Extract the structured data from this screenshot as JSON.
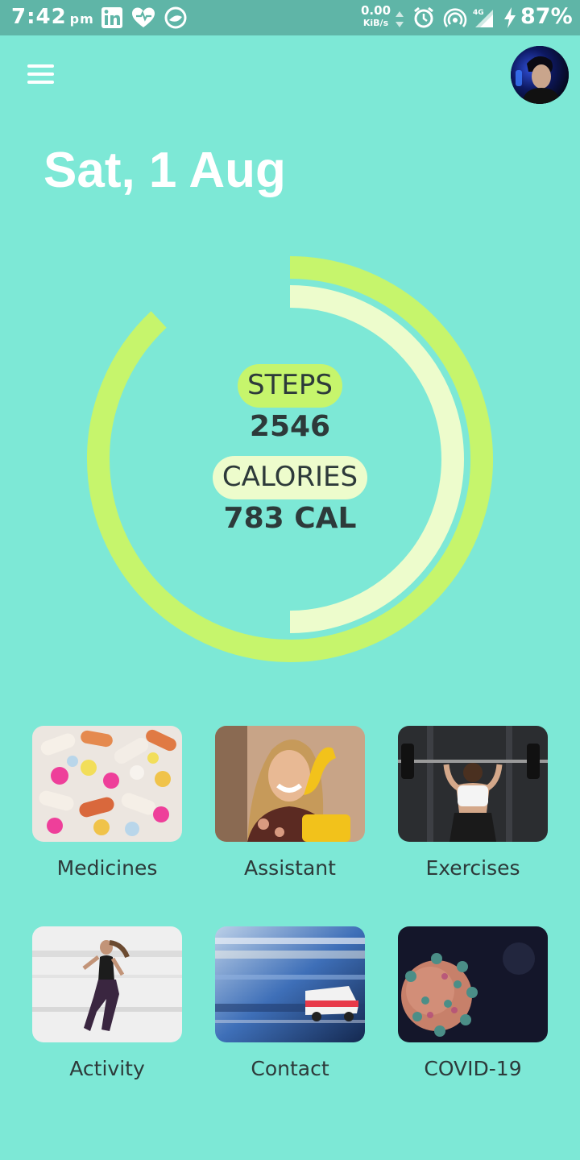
{
  "status_bar": {
    "time": "7:42",
    "ampm": "pm",
    "speed_value": "0.00",
    "speed_unit": "KiB/s",
    "network": "4G",
    "battery": "87%",
    "icons": [
      "linkedin-icon",
      "heart-icon",
      "app-icon",
      "arrows-icon",
      "alarm-icon",
      "hotspot-icon",
      "signal-icon",
      "charging-icon"
    ]
  },
  "header": {
    "menu_icon": "hamburger-menu-icon",
    "avatar": "user-avatar"
  },
  "date": "Sat, 1 Aug",
  "summary": {
    "steps_label": "STEPS",
    "steps_value": "2546",
    "calories_label": "CALORIES",
    "calories_value": "783 CAL",
    "steps_progress": 0.88,
    "calories_progress": 0.5,
    "colors": {
      "outer_ring": "#c6f56c",
      "inner_ring": "#edfccc",
      "background": "#7de8d6"
    }
  },
  "tiles": [
    {
      "label": "Medicines"
    },
    {
      "label": "Assistant"
    },
    {
      "label": "Exercises"
    },
    {
      "label": "Activity"
    },
    {
      "label": "Contact"
    },
    {
      "label": "COVID-19"
    }
  ]
}
